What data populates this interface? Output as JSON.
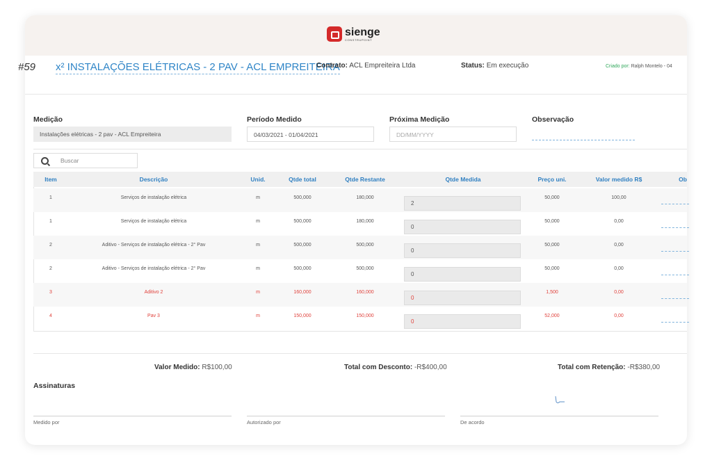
{
  "brand": {
    "name": "sienge",
    "sub": "CONSTRUPOINT"
  },
  "header": {
    "code": "#59",
    "title": "x² INSTALAÇÕES ELÉTRICAS - 2 PAV - ACL EMPREITEIRA",
    "contrato_label": "Contrato:",
    "contrato_value": "ACL Empreiteira Ltda",
    "status_label": "Status:",
    "status_value": "Em execução",
    "criado_label": "Criado por:",
    "criado_value": "Ralph Montelo - 04"
  },
  "fields": {
    "medicao_label": "Medição",
    "medicao_value": "Instalações elétricas - 2 pav - ACL Empreiteira",
    "periodo_label": "Período Medido",
    "periodo_value": "04/03/2021 - 01/04/2021",
    "proxima_label": "Próxima Medição",
    "proxima_placeholder": "DD/MM/YYYY",
    "obs_label": "Observação"
  },
  "search": {
    "placeholder": "Buscar"
  },
  "table": {
    "headers": [
      "Item",
      "Descrição",
      "Unid.",
      "Qtde total",
      "Qtde Restante",
      "Qtde Medida",
      "Preço uni.",
      "Valor medido R$",
      "Ob"
    ],
    "rows": [
      {
        "item": "1",
        "desc": "Serviços de instalação elétrica",
        "unid": "m",
        "total": "500,000",
        "restante": "180,000",
        "medida": "2",
        "preco": "50,000",
        "valor": "100,00",
        "red": false
      },
      {
        "item": "1",
        "desc": "Serviços de instalação elétrica",
        "unid": "m",
        "total": "500,000",
        "restante": "180,000",
        "medida": "0",
        "preco": "50,000",
        "valor": "0,00",
        "red": false
      },
      {
        "item": "2",
        "desc": "Aditivo - Serviços de instalação elétrica - 2° Pav",
        "unid": "m",
        "total": "500,000",
        "restante": "500,000",
        "medida": "0",
        "preco": "50,000",
        "valor": "0,00",
        "red": false
      },
      {
        "item": "2",
        "desc": "Aditivo - Serviços de instalação elétrica - 2° Pav",
        "unid": "m",
        "total": "500,000",
        "restante": "500,000",
        "medida": "0",
        "preco": "50,000",
        "valor": "0,00",
        "red": false
      },
      {
        "item": "3",
        "desc": "Aditivo 2",
        "unid": "m",
        "total": "160,000",
        "restante": "160,000",
        "medida": "0",
        "preco": "1,500",
        "valor": "0,00",
        "red": true
      },
      {
        "item": "4",
        "desc": "Pav 3",
        "unid": "m",
        "total": "150,000",
        "restante": "150,000",
        "medida": "0",
        "preco": "52,000",
        "valor": "0,00",
        "red": true
      }
    ]
  },
  "totals": {
    "valor_label": "Valor Medido:",
    "valor_value": "R$100,00",
    "desconto_label": "Total com Desconto:",
    "desconto_value": "-R$400,00",
    "retencao_label": "Total com Retenção:",
    "retencao_value": "-R$380,00"
  },
  "signatures": {
    "title": "Assinaturas",
    "medido": "Medido por",
    "autorizado": "Autorizado por",
    "acordo": "De acordo"
  },
  "colors": {
    "accent": "#2f85c7",
    "brand": "#d42a2a",
    "warning": "#e0423c",
    "creator": "#2fa75a"
  }
}
